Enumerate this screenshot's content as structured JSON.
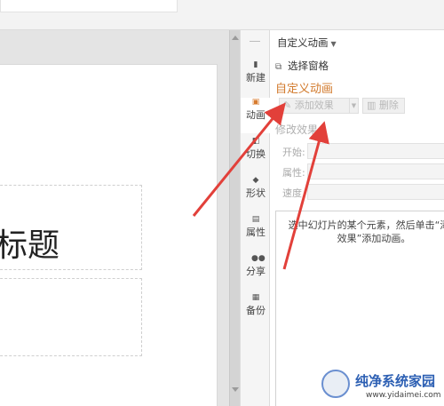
{
  "rail": {
    "items": [
      {
        "label": "新建",
        "icon": "new-file-icon"
      },
      {
        "label": "动画",
        "icon": "animation-icon"
      },
      {
        "label": "切换",
        "icon": "transition-icon"
      },
      {
        "label": "形状",
        "icon": "shapes-icon"
      },
      {
        "label": "属性",
        "icon": "properties-icon"
      },
      {
        "label": "分享",
        "icon": "share-icon"
      },
      {
        "label": "备份",
        "icon": "backup-icon"
      }
    ]
  },
  "slide": {
    "title_placeholder": "标题"
  },
  "pane": {
    "header": "自定义动画",
    "select_pane": "选择窗格",
    "title": "自定义动画",
    "add_effect": "添加效果",
    "delete": "删除",
    "modify_effect": "修改效果",
    "start_label": "开始:",
    "property_label": "属性:",
    "speed_label": "速度",
    "hint": "选中幻灯片的某个元素，然后单击“添加效果”添加动画。"
  },
  "watermark": {
    "text": "纯净系统家园",
    "url": "www.yidaimei.com"
  },
  "colors": {
    "accent": "#d27a2c",
    "arrow": "#e2403a"
  }
}
